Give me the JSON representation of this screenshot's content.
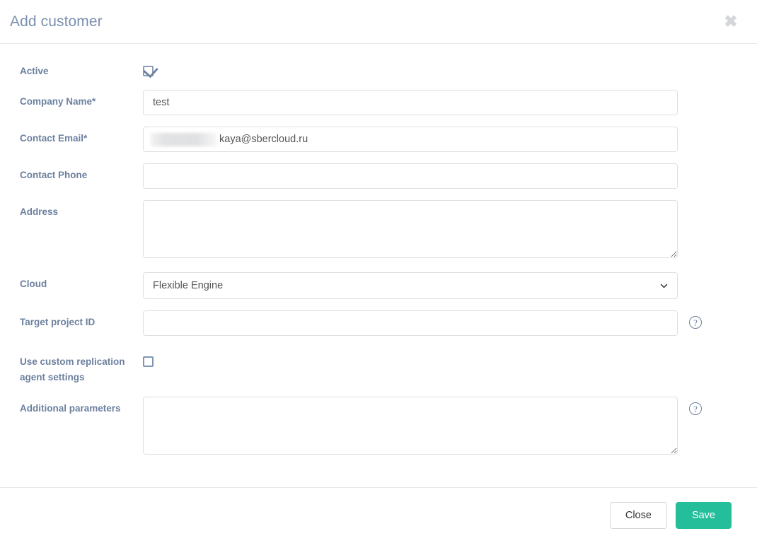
{
  "modal": {
    "title": "Add customer",
    "close_icon": "close-icon"
  },
  "form": {
    "active": {
      "label": "Active",
      "checked": true
    },
    "company_name": {
      "label": "Company Name*",
      "value": "test",
      "placeholder": ""
    },
    "contact_email": {
      "label": "Contact Email*",
      "redacted_prefix": "",
      "visible_value": "kaya@sbercloud.ru",
      "placeholder": ""
    },
    "contact_phone": {
      "label": "Contact Phone",
      "value": "",
      "placeholder": ""
    },
    "address": {
      "label": "Address",
      "value": "",
      "placeholder": ""
    },
    "cloud": {
      "label": "Cloud",
      "selected": "Flexible Engine",
      "chevron_icon": "chevron-down-icon"
    },
    "target_project_id": {
      "label": "Target project ID",
      "value": "",
      "placeholder": "",
      "help_icon": "help-circle-icon"
    },
    "use_custom_replication": {
      "label": "Use custom replication agent settings",
      "checked": false
    },
    "additional_parameters": {
      "label": "Additional parameters",
      "value": "",
      "placeholder": "",
      "help_icon": "help-circle-icon"
    }
  },
  "footer": {
    "close_label": "Close",
    "save_label": "Save"
  },
  "colors": {
    "label_text": "#6c809f",
    "title_text": "#7b8fae",
    "save_button": "#24be9b",
    "input_border": "#dedfe0",
    "checkbox_border": "#8095b4"
  }
}
